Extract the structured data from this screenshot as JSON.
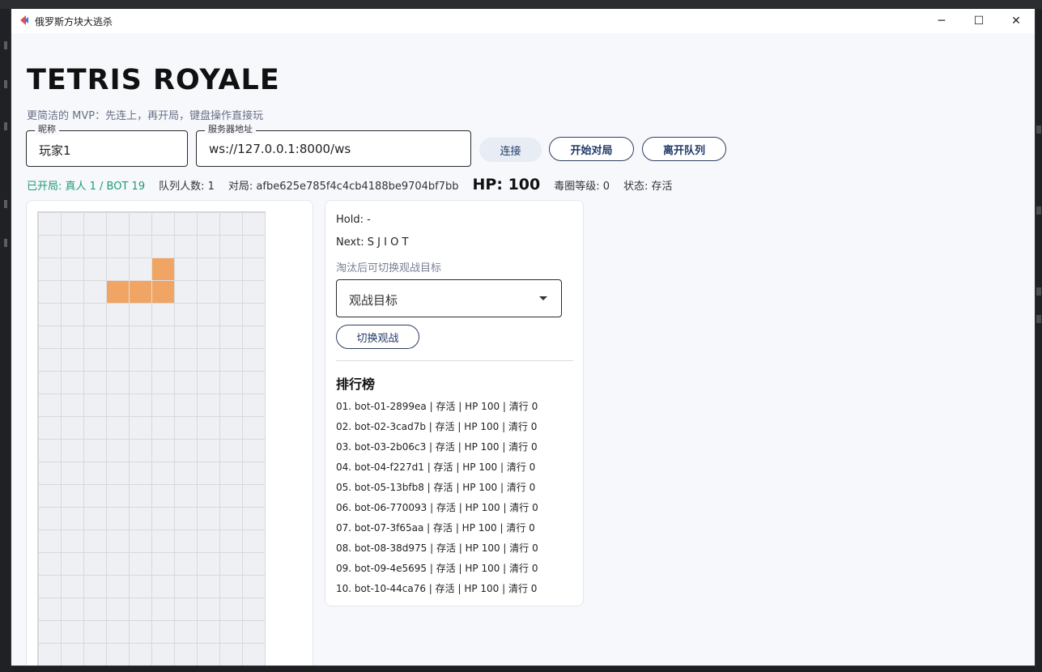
{
  "window": {
    "title": "俄罗斯方块大逃杀",
    "minimize_label": "─",
    "maximize_label": "☐",
    "close_label": "✕"
  },
  "header": {
    "title": "TETRIS ROYALE",
    "subtitle": "更简洁的 MVP：先连上，再开局，键盘操作直接玩"
  },
  "form": {
    "nickname": {
      "label": "昵称",
      "value": "玩家1"
    },
    "server": {
      "label": "服务器地址",
      "value": "ws://127.0.0.1:8000/ws"
    },
    "connect_label": "连接",
    "start_label": "开始对局",
    "leave_label": "离开队列"
  },
  "status": {
    "started": "已开局: 真人 1 / BOT 19",
    "queue": "队列人数: 1",
    "match": "对局: afbe625e785f4c4cb4188be9704bf7bb",
    "hp": "HP: 100",
    "poison": "毒圈等级: 0",
    "state": "状态: 存活"
  },
  "board": {
    "cols": 10,
    "rows": 20,
    "piece_color": "#f0a564",
    "filled_cells": [
      [
        5,
        2
      ],
      [
        3,
        3
      ],
      [
        4,
        3
      ],
      [
        5,
        3
      ]
    ]
  },
  "side": {
    "hold": "Hold: -",
    "next": "Next: S J I O T",
    "hint": "淘汰后可切换观战目标",
    "spectate_select": "观战目标",
    "switch_label": "切换观战"
  },
  "leaderboard": {
    "title": "排行榜",
    "entries": [
      "01. bot-01-2899ea | 存活 | HP 100 | 清行 0",
      "02. bot-02-3cad7b | 存活 | HP 100 | 清行 0",
      "03. bot-03-2b06c3 | 存活 | HP 100 | 清行 0",
      "04. bot-04-f227d1 | 存活 | HP 100 | 清行 0",
      "05. bot-05-13bfb8 | 存活 | HP 100 | 清行 0",
      "06. bot-06-770093 | 存活 | HP 100 | 清行 0",
      "07. bot-07-3f65aa | 存活 | HP 100 | 清行 0",
      "08. bot-08-38d975 | 存活 | HP 100 | 清行 0",
      "09. bot-09-4e5695 | 存活 | HP 100 | 清行 0",
      "10. bot-10-44ca76 | 存活 | HP 100 | 清行 0"
    ]
  }
}
